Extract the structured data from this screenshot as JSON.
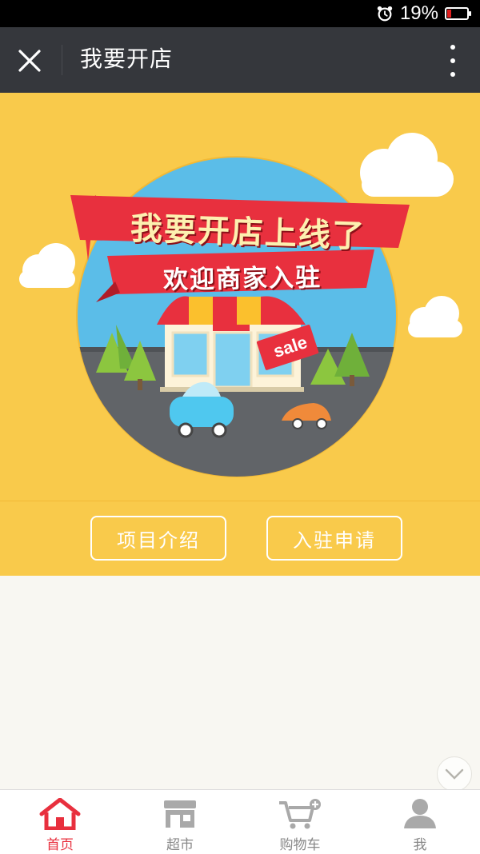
{
  "status_bar": {
    "battery_text": "19%",
    "battery_level": 0.19
  },
  "header": {
    "title": "我要开店"
  },
  "banner": {
    "headline": "我要开店上线了",
    "subheadline": "欢迎商家入驻",
    "sign_text": "sale"
  },
  "actions": {
    "intro_label": "项目介绍",
    "apply_label": "入驻申请"
  },
  "tab_bar": {
    "active_color": "#e8303e",
    "items": [
      {
        "label": "首页",
        "icon": "home-icon",
        "active": true
      },
      {
        "label": "超市",
        "icon": "store-icon",
        "active": false
      },
      {
        "label": "购物车",
        "icon": "cart-icon",
        "active": false
      },
      {
        "label": "我",
        "icon": "user-icon",
        "active": false
      }
    ]
  }
}
